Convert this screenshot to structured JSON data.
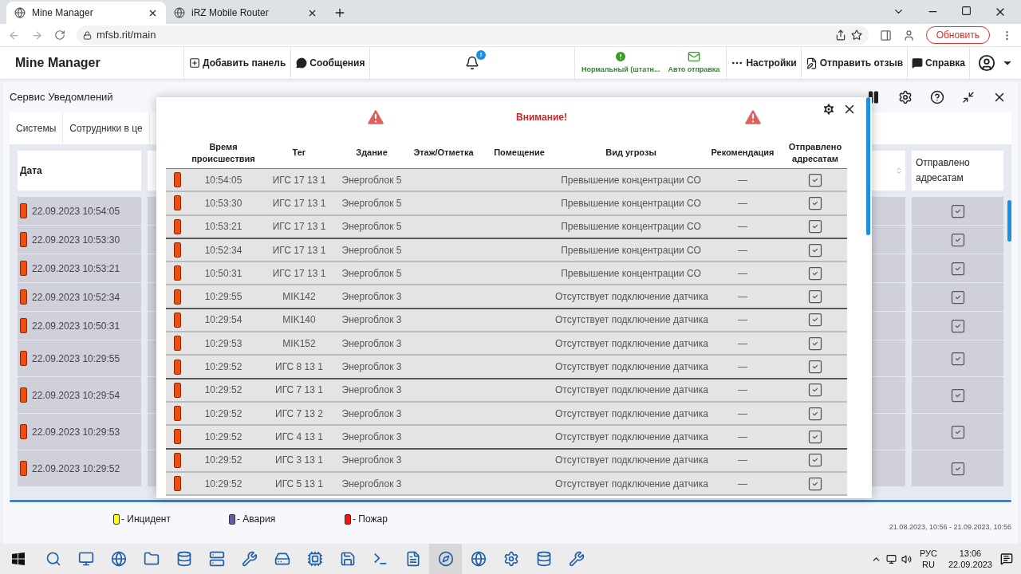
{
  "browser": {
    "tabs": [
      {
        "title": "Mine Manager",
        "selected": true
      },
      {
        "title": "iRZ Mobile Router",
        "selected": false
      }
    ],
    "url": "mfsb.rit/main",
    "update_button": "Обновить"
  },
  "header": {
    "app_title": "Mine Manager",
    "actions": [
      "Добавить панель",
      "Сообщения"
    ],
    "bell_badge": "!",
    "status_mode": "Нормальный (штатн...",
    "auto_send": "Авто отправка",
    "menu": [
      "Настройки",
      "Отправить отзыв",
      "Справка"
    ]
  },
  "panel": {
    "title": "Сервис Уведомлений",
    "tabs": [
      "Системы",
      "Сотрудники в це"
    ],
    "table": {
      "columns": [
        "Дата",
        "Отправлено адресатам"
      ],
      "rows": [
        {
          "date": "22.09.2023 10:54:05",
          "sent": true
        },
        {
          "date": "22.09.2023 10:53:30",
          "sent": true
        },
        {
          "date": "22.09.2023 10:53:21",
          "sent": true
        },
        {
          "date": "22.09.2023 10:52:34",
          "sent": true
        },
        {
          "date": "22.09.2023 10:50:31",
          "sent": true
        },
        {
          "date": "22.09.2023 10:29:55",
          "sent": true
        },
        {
          "date": "22.09.2023 10:29:54",
          "sent": true
        },
        {
          "date": "22.09.2023 10:29:53",
          "sent": true
        },
        {
          "date": "22.09.2023 10:29:52",
          "sent": true
        }
      ]
    },
    "legend": [
      {
        "label": "- Инцидент",
        "color": "#ffff00"
      },
      {
        "label": "- Авария",
        "color": "#6b5a9e"
      },
      {
        "label": "- Пожар",
        "color": "#ff1010"
      }
    ],
    "date_range": "21.08.2023, 10:56 - 21.09.2023, 10:56"
  },
  "modal": {
    "title": "Внимание!",
    "columns": [
      "Время происшествия",
      "Тег",
      "Здание",
      "Этаж/Отметка",
      "Помещение",
      "Вид угрозы",
      "Рекомендация",
      "Отправлено адресатам"
    ],
    "rows": [
      {
        "time": "10:54:05",
        "tag": "ИГС 17 13 1",
        "building": "Энергоблок 5",
        "threat": "Превышение концентрации СО",
        "recommendation": "—",
        "sent": true
      },
      {
        "time": "10:53:30",
        "tag": "ИГС 17 13 1",
        "building": "Энергоблок 5",
        "threat": "Превышение концентрации СО",
        "recommendation": "—",
        "sent": true
      },
      {
        "time": "10:53:21",
        "tag": "ИГС 17 13 1",
        "building": "Энергоблок 5",
        "threat": "Превышение концентрации СО",
        "recommendation": "—",
        "sent": true
      },
      {
        "time": "10:52:34",
        "tag": "ИГС 17 13 1",
        "building": "Энергоблок 5",
        "threat": "Превышение концентрации СО",
        "recommendation": "—",
        "sent": true
      },
      {
        "time": "10:50:31",
        "tag": "ИГС 17 13 1",
        "building": "Энергоблок 5",
        "threat": "Превышение концентрации СО",
        "recommendation": "—",
        "sent": true
      },
      {
        "time": "10:29:55",
        "tag": "MIK142",
        "building": "Энергоблок 3",
        "threat": "Отсутствует подключение датчика",
        "recommendation": "—",
        "sent": true
      },
      {
        "time": "10:29:54",
        "tag": "MIK140",
        "building": "Энергоблок 3",
        "threat": "Отсутствует подключение датчика",
        "recommendation": "—",
        "sent": true
      },
      {
        "time": "10:29:53",
        "tag": "MIK152",
        "building": "Энергоблок 3",
        "threat": "Отсутствует подключение датчика",
        "recommendation": "—",
        "sent": true
      },
      {
        "time": "10:29:52",
        "tag": "ИГС 8 13 1",
        "building": "Энергоблок 3",
        "threat": "Отсутствует подключение датчика",
        "recommendation": "—",
        "sent": true
      },
      {
        "time": "10:29:52",
        "tag": "ИГС 7 13 1",
        "building": "Энергоблок 3",
        "threat": "Отсутствует подключение датчика",
        "recommendation": "—",
        "sent": true
      },
      {
        "time": "10:29:52",
        "tag": "ИГС 7 13 2",
        "building": "Энергоблок 3",
        "threat": "Отсутствует подключение датчика",
        "recommendation": "—",
        "sent": true
      },
      {
        "time": "10:29:52",
        "tag": "ИГС 4 13 1",
        "building": "Энергоблок 3",
        "threat": "Отсутствует подключение датчика",
        "recommendation": "—",
        "sent": true
      },
      {
        "time": "10:29:52",
        "tag": "ИГС 3 13 1",
        "building": "Энергоблок 3",
        "threat": "Отсутствует подключение датчика",
        "recommendation": "—",
        "sent": true
      },
      {
        "time": "10:29:52",
        "tag": "ИГС 5 13 1",
        "building": "Энергоблок 3",
        "threat": "Отсутствует подключение датчика",
        "recommendation": "—",
        "sent": true
      }
    ]
  },
  "taskbar": {
    "language": "РУС",
    "layout": "RU",
    "time": "13:06",
    "date": "22.09.2023"
  }
}
